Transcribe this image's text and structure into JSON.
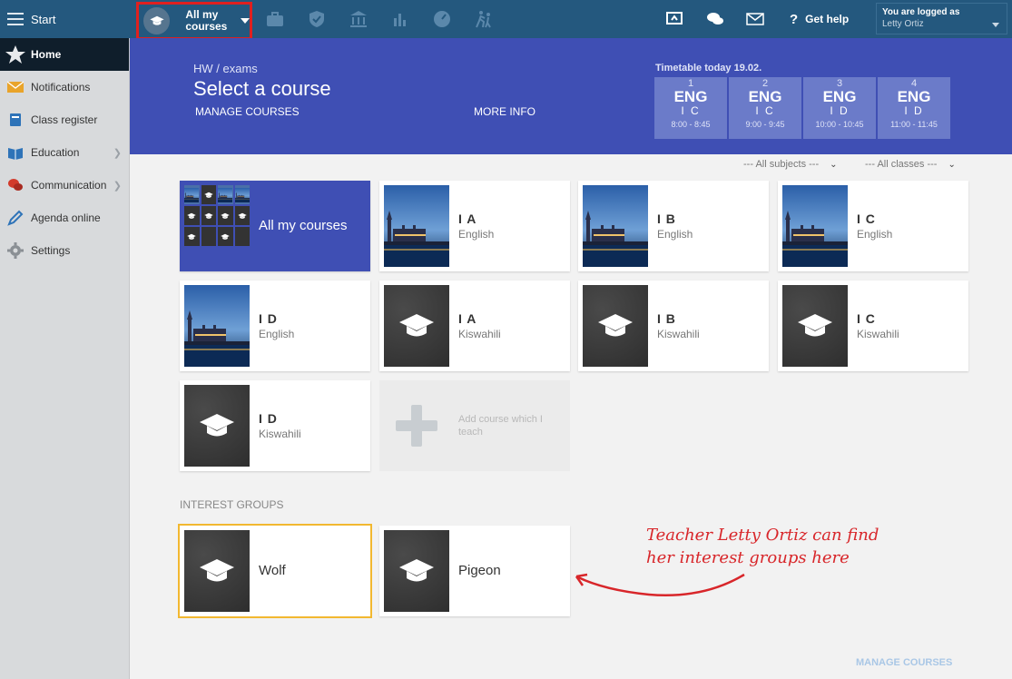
{
  "topbar": {
    "start_label": "Start",
    "course_switch_label": "All my courses",
    "help_label": "Get help",
    "user_prefix": "You are logged as",
    "user_name": "Letty Ortiz"
  },
  "sidebar": {
    "items": [
      {
        "label": "Home",
        "icon": "star-icon"
      },
      {
        "label": "Notifications",
        "icon": "envelope-icon"
      },
      {
        "label": "Class register",
        "icon": "book-icon"
      },
      {
        "label": "Education",
        "icon": "education-icon"
      },
      {
        "label": "Communication",
        "icon": "chat-icon"
      },
      {
        "label": "Agenda online",
        "icon": "pen-icon"
      },
      {
        "label": "Settings",
        "icon": "gear-icon"
      }
    ]
  },
  "header": {
    "breadcrumb": "HW / exams",
    "title": "Select a course",
    "manage_courses": "MANAGE COURSES",
    "more_info": "MORE INFO"
  },
  "timetable": {
    "title": "Timetable today 19.02.",
    "lessons": [
      {
        "num": "1",
        "subject": "ENG",
        "cls": "I C",
        "time": "8:00 - 8:45"
      },
      {
        "num": "2",
        "subject": "ENG",
        "cls": "I C",
        "time": "9:00 - 9:45"
      },
      {
        "num": "3",
        "subject": "ENG",
        "cls": "I D",
        "time": "10:00 - 10:45"
      },
      {
        "num": "4",
        "subject": "ENG",
        "cls": "I D",
        "time": "11:00 - 11:45"
      }
    ]
  },
  "filters": {
    "subjects": "--- All subjects ---",
    "classes": "--- All classes ---"
  },
  "courses": {
    "all_label": "All my courses",
    "items": [
      {
        "cls": "I A",
        "subject": "English"
      },
      {
        "cls": "I B",
        "subject": "English"
      },
      {
        "cls": "I C",
        "subject": "English"
      },
      {
        "cls": "I D",
        "subject": "English"
      },
      {
        "cls": "I A",
        "subject": "Kiswahili"
      },
      {
        "cls": "I B",
        "subject": "Kiswahili"
      },
      {
        "cls": "I C",
        "subject": "Kiswahili"
      },
      {
        "cls": "I D",
        "subject": "Kiswahili"
      }
    ],
    "add_label": "Add course which I teach"
  },
  "interest_groups": {
    "label": "INTEREST GROUPS",
    "items": [
      "Wolf",
      "Pigeon"
    ]
  },
  "annotation": {
    "line1": "Teacher Letty Ortiz can find",
    "line2": "her interest groups here"
  },
  "footer": {
    "manage_courses": "MANAGE COURSES"
  },
  "colors": {
    "topbar": "#24587e",
    "banner": "#3f4fb4",
    "highlight": "#e0201f",
    "selected_border": "#f2b830"
  }
}
